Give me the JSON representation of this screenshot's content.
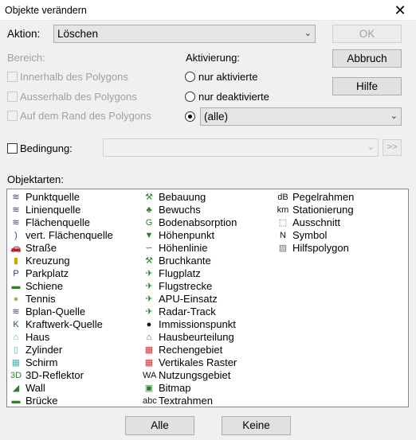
{
  "window": {
    "title": "Objekte verändern",
    "close": "✕"
  },
  "aktion": {
    "label": "Aktion:",
    "value": "Löschen",
    "arrow": "⌄"
  },
  "buttons": {
    "ok": "OK",
    "abbruch": "Abbruch",
    "hilfe": "Hilfe",
    "more": ">>",
    "alle": "Alle",
    "keine": "Keine"
  },
  "bereich": {
    "label": "Bereich:",
    "options": [
      "Innerhalb des Polygons",
      "Ausserhalb des Polygons",
      "Auf dem Rand des Polygons"
    ]
  },
  "aktivierung": {
    "label": "Aktivierung:",
    "options": [
      "nur aktivierte",
      "nur deaktivierte"
    ],
    "selected_value": "(alle)",
    "arrow": "⌄"
  },
  "bedingung": {
    "label": "Bedingung:",
    "arrow": "⌄"
  },
  "objektarten": {
    "label": "Objektarten:",
    "col1": [
      {
        "text": "Punktquelle",
        "icon": "≋",
        "color": "#1a4fa0"
      },
      {
        "text": "Linienquelle",
        "icon": "≋",
        "color": "#1a4fa0"
      },
      {
        "text": "Flächenquelle",
        "icon": "≋",
        "color": "#1a4fa0"
      },
      {
        "text": "vert. Flächenquelle",
        "icon": ")",
        "color": "#1a4fa0"
      },
      {
        "text": "Straße",
        "icon": "🚗",
        "color": "#2e7d32"
      },
      {
        "text": "Kreuzung",
        "icon": "▮",
        "color": "#d4a400"
      },
      {
        "text": "Parkplatz",
        "icon": "P",
        "color": "#1a3f8a"
      },
      {
        "text": "Schiene",
        "icon": "▬",
        "color": "#2e7d32"
      },
      {
        "text": "Tennis",
        "icon": "●",
        "color": "#8bc34a"
      },
      {
        "text": "Bplan-Quelle",
        "icon": "≋",
        "color": "#1a4fa0"
      },
      {
        "text": "Kraftwerk-Quelle",
        "icon": "K",
        "color": "#1b5e20"
      },
      {
        "text": "Haus",
        "icon": "⌂",
        "color": "#4db6ac"
      },
      {
        "text": "Zylinder",
        "icon": "▯",
        "color": "#4db6ac"
      },
      {
        "text": "Schirm",
        "icon": "▦",
        "color": "#4db6ac"
      },
      {
        "text": "3D-Reflektor",
        "icon": "3D",
        "color": "#2e7d32"
      },
      {
        "text": "Wall",
        "icon": "◢",
        "color": "#2e7d32"
      },
      {
        "text": "Brücke",
        "icon": "▬",
        "color": "#2e7d32"
      }
    ],
    "col2": [
      {
        "text": "Bebauung",
        "icon": "⚒",
        "color": "#2e7d32"
      },
      {
        "text": "Bewuchs",
        "icon": "♣",
        "color": "#2e7d32"
      },
      {
        "text": "Bodenabsorption",
        "icon": "G",
        "color": "#2e7d32"
      },
      {
        "text": "Höhenpunkt",
        "icon": "▼",
        "color": "#2e7d32"
      },
      {
        "text": "Höhenlinie",
        "icon": "∽",
        "color": "#2e7d32"
      },
      {
        "text": "Bruchkante",
        "icon": "⚒",
        "color": "#2e7d32"
      },
      {
        "text": "Flugplatz",
        "icon": "✈",
        "color": "#2e7d32"
      },
      {
        "text": "Flugstrecke",
        "icon": "✈",
        "color": "#2e7d32"
      },
      {
        "text": "APU-Einsatz",
        "icon": "✈",
        "color": "#2e7d32"
      },
      {
        "text": "Radar-Track",
        "icon": "✈",
        "color": "#2e7d32"
      },
      {
        "text": "Immissionspunkt",
        "icon": "●",
        "color": "#111111"
      },
      {
        "text": "Hausbeurteilung",
        "icon": "⌂",
        "color": "#2e7d32"
      },
      {
        "text": "Rechengebiet",
        "icon": "▦",
        "color": "#d32f2f"
      },
      {
        "text": "Vertikales Raster",
        "icon": "▦",
        "color": "#d32f2f"
      },
      {
        "text": "Nutzungsgebiet",
        "icon": "WA",
        "color": "#111111"
      },
      {
        "text": "Bitmap",
        "icon": "▣",
        "color": "#2e7d32"
      },
      {
        "text": "Textrahmen",
        "icon": "abc",
        "color": "#111111"
      }
    ],
    "col3": [
      {
        "text": "Pegelrahmen",
        "icon": "dB",
        "color": "#111111"
      },
      {
        "text": "Stationierung",
        "icon": "km",
        "color": "#111111"
      },
      {
        "text": "Ausschnitt",
        "icon": "⬚",
        "color": "#555555"
      },
      {
        "text": "Symbol",
        "icon": "N",
        "color": "#111111"
      },
      {
        "text": "Hilfspolygon",
        "icon": "▨",
        "color": "#777777"
      }
    ]
  }
}
